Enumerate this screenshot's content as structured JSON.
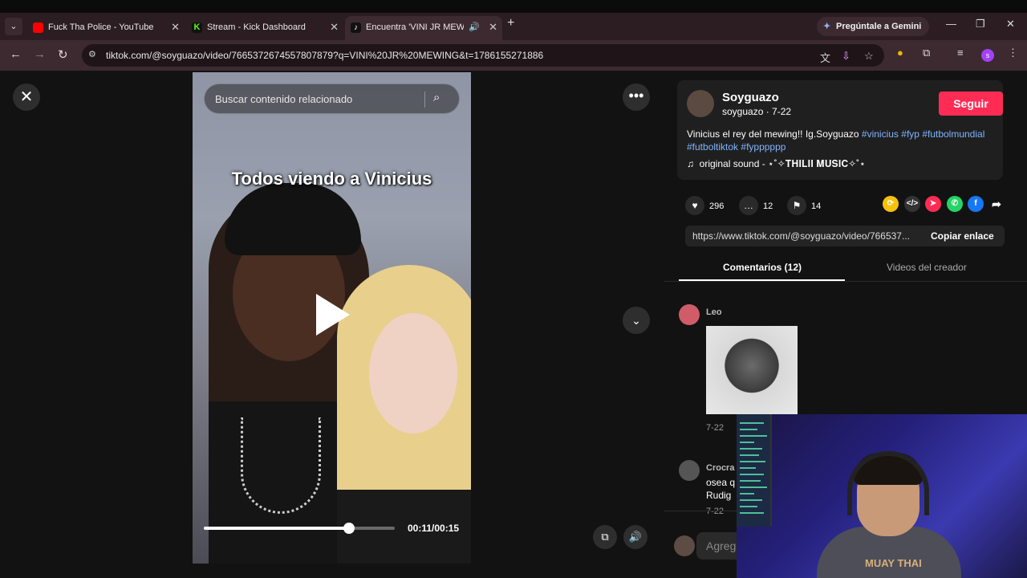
{
  "browser": {
    "tabs": [
      {
        "title": "Fuck Tha Police - YouTube",
        "favicon": "youtube-icon",
        "color": "#ff0000",
        "active": false
      },
      {
        "title": "Stream - Kick Dashboard",
        "favicon": "kick-icon",
        "color": "#53fc18",
        "active": false
      },
      {
        "title": "Encuentra 'VINI JR MEWING",
        "favicon": "tiktok-icon",
        "color": "#111111",
        "active": true
      }
    ],
    "gemini_label": "Pregúntale a Gemini",
    "url": "tiktok.com/@soyguazo/video/7665372674557807879?q=VINI%20JR%20MEWING&t=1786155271886",
    "profile_initial": "s"
  },
  "video": {
    "search_placeholder": "Buscar contenido relacionado",
    "caption": "Todos viendo a Vinicius",
    "time": "00:11/00:15",
    "progress": 0.76
  },
  "post": {
    "username": "Soyguazo",
    "handle_date": "soyguazo · 7-22",
    "follow_label": "Seguir",
    "description_text": "Vinicius el rey del mewing!! Ig.Soyguazo ",
    "hashtags": [
      "#vinicius",
      "#fyp",
      "#futbolmundial",
      "#futboltiktok",
      "#fypppppp"
    ],
    "sound": "original sound - ⋆˚✧𝐓𝐇𝐈𝐋𝐈𝐈 𝐌𝐔𝐒𝐈𝐂✧˚⋆",
    "likes": "296",
    "comments": "12",
    "saves": "14",
    "link": "https://www.tiktok.com/@soyguazo/video/766537...",
    "copy_label": "Copiar enlace",
    "tab_comments": "Comentarios (12)",
    "tab_creator": "Videos del creador"
  },
  "comments": [
    {
      "name": "Leo",
      "date": "7-22",
      "text": ""
    },
    {
      "name": "Crocra",
      "date": "7-22",
      "text": "osea q",
      "text2": "Rudig"
    }
  ],
  "comment_input_placeholder": "Agreg",
  "webcam": {
    "shirt_text": "MUAY THAI"
  }
}
